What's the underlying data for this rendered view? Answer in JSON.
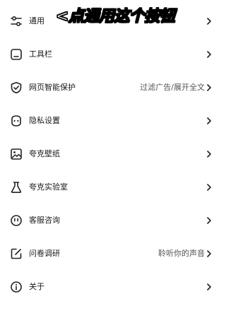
{
  "overlay_caption": "<点通用这个按钮",
  "menu": {
    "items": [
      {
        "label": "通用",
        "value": "",
        "icon": "sliders-icon"
      },
      {
        "label": "工具栏",
        "value": "",
        "icon": "toolbar-icon"
      },
      {
        "label": "网页智能保护",
        "value": "过滤广告/展开全文",
        "icon": "shield-check-icon"
      },
      {
        "label": "隐私设置",
        "value": "",
        "icon": "privacy-mask-icon"
      },
      {
        "label": "夸克壁纸",
        "value": "",
        "icon": "wallpaper-icon"
      },
      {
        "label": "夸克实验室",
        "value": "",
        "icon": "flask-icon"
      },
      {
        "label": "客服咨询",
        "value": "",
        "icon": "support-face-icon"
      },
      {
        "label": "问卷调研",
        "value": "聆听你的声音",
        "icon": "survey-edit-icon"
      },
      {
        "label": "关于",
        "value": "",
        "icon": "info-icon"
      }
    ]
  }
}
